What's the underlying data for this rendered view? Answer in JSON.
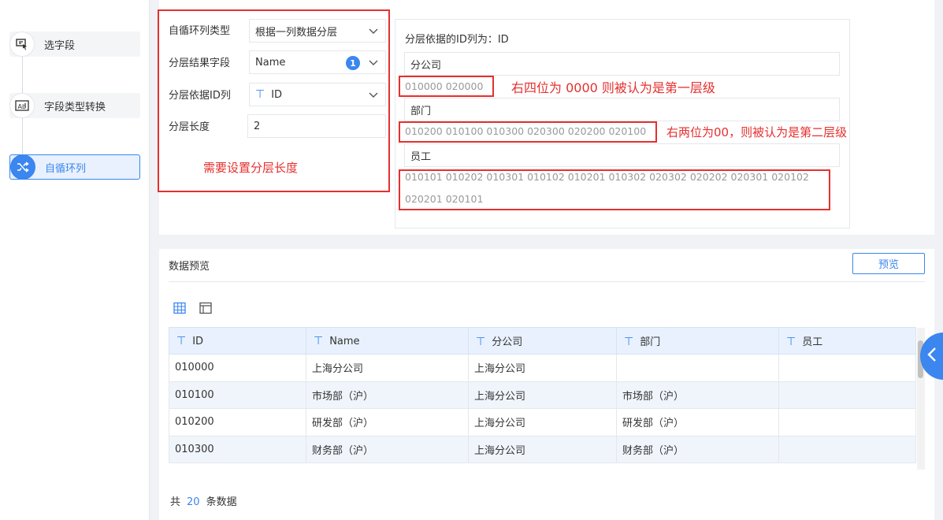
{
  "steps": [
    {
      "label": "选字段",
      "icon": "select-field-icon"
    },
    {
      "label": "字段类型转换",
      "icon": "type-convert-icon"
    },
    {
      "label": "自循环列",
      "icon": "shuffle-icon"
    }
  ],
  "config": {
    "type_label": "自循环列类型",
    "type_value": "根据一列数据分层",
    "result_label": "分层结果字段",
    "result_value": "Name",
    "result_badge": "1",
    "id_label": "分层依据ID列",
    "id_value": "ID",
    "length_label": "分层长度",
    "length_value": "2",
    "annotation_left": "需要设置分层长度"
  },
  "hierarchy": {
    "title": "分层依据的ID列为：ID",
    "levels": [
      {
        "name": "分公司",
        "ids": "010000  020000"
      },
      {
        "name": "部门",
        "ids": "010200  010100  010300  020300  020200  020100"
      },
      {
        "name": "员工",
        "ids_line1": "010101  010202  010301  010102  010201  010302  020302  020202  020301  020102",
        "ids_line2": "020201  020101"
      }
    ],
    "annotation_level1": "右四位为 0000 则被认为是第一层级",
    "annotation_level2": "右两位为00，则被认为是第二层级"
  },
  "preview": {
    "title": "数据预览",
    "button": "预览",
    "columns": [
      "ID",
      "Name",
      "分公司",
      "部门",
      "员工"
    ],
    "rows": [
      [
        "010000",
        "上海分公司",
        "上海分公司",
        "",
        ""
      ],
      [
        "010100",
        "市场部（沪）",
        "上海分公司",
        "市场部（沪）",
        ""
      ],
      [
        "010200",
        "研发部（沪）",
        "上海分公司",
        "研发部（沪）",
        ""
      ],
      [
        "010300",
        "财务部（沪）",
        "上海分公司",
        "财务部（沪）",
        ""
      ]
    ],
    "footer_prefix": "共",
    "footer_count": "20",
    "footer_suffix": "条数据"
  },
  "colors": {
    "accent": "#3b86ef",
    "annotation": "#e5302f"
  }
}
